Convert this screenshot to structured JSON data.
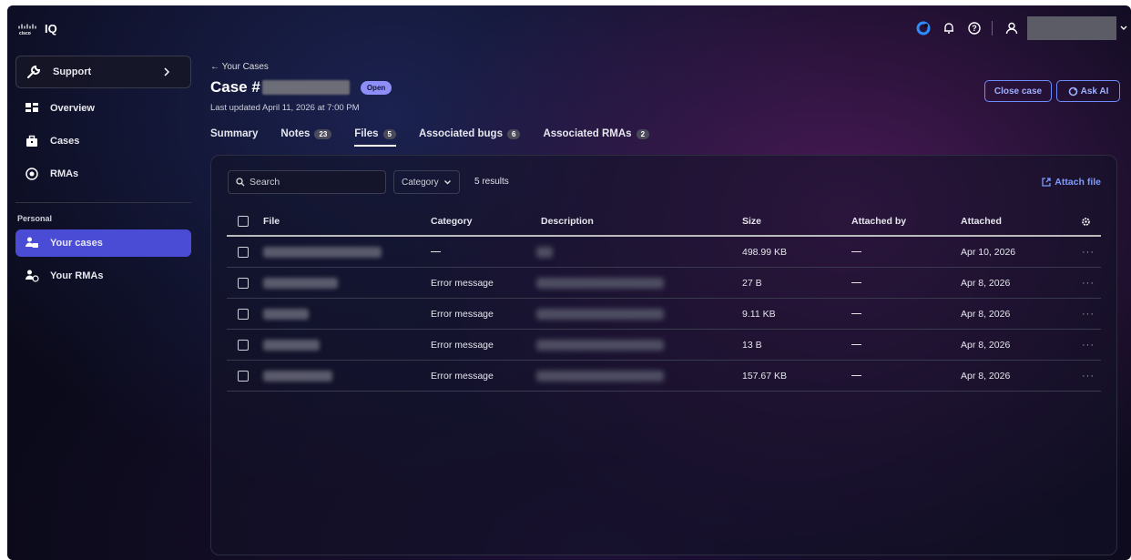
{
  "brand": {
    "name": "IQ",
    "company": "cisco"
  },
  "sidebar": {
    "support_label": "Support",
    "items": [
      {
        "label": "Overview"
      },
      {
        "label": "Cases"
      },
      {
        "label": "RMAs"
      }
    ],
    "personal_caption": "Personal",
    "personal_items": [
      {
        "label": "Your cases"
      },
      {
        "label": "Your RMAs"
      }
    ]
  },
  "header": {
    "back_label": "← Your Cases",
    "case_title": "Case #",
    "status_badge": "Open",
    "last_updated": "Last updated April 11, 2026 at 7:00 PM",
    "close_case_label": "Close case",
    "ask_ai_label": "Ask AI"
  },
  "tabs": [
    {
      "label": "Summary",
      "count": ""
    },
    {
      "label": "Notes",
      "count": "23"
    },
    {
      "label": "Files",
      "count": "5"
    },
    {
      "label": "Associated bugs",
      "count": "6"
    },
    {
      "label": "Associated RMAs",
      "count": "2"
    }
  ],
  "toolbar": {
    "search_placeholder": "Search",
    "category_label": "Category",
    "results": "5 results",
    "attach_label": "Attach file"
  },
  "table": {
    "columns": [
      "File",
      "Category",
      "Description",
      "Size",
      "Attached by",
      "Attached"
    ],
    "rows": [
      {
        "category": "",
        "size": "498.99 KB",
        "attached": "Apr 10, 2026"
      },
      {
        "category": "Error message",
        "size": "27 B",
        "attached": "Apr 8, 2026"
      },
      {
        "category": "Error message",
        "size": "9.11 KB",
        "attached": "Apr 8, 2026"
      },
      {
        "category": "Error message",
        "size": "13 B",
        "attached": "Apr 8, 2026"
      },
      {
        "category": "Error message",
        "size": "157.67 KB",
        "attached": "Apr 8, 2026"
      }
    ],
    "more_label": "···"
  },
  "colors": {
    "accent": "#4a4cd6",
    "link": "#7e9cff",
    "badge": "#8e8ef8"
  }
}
